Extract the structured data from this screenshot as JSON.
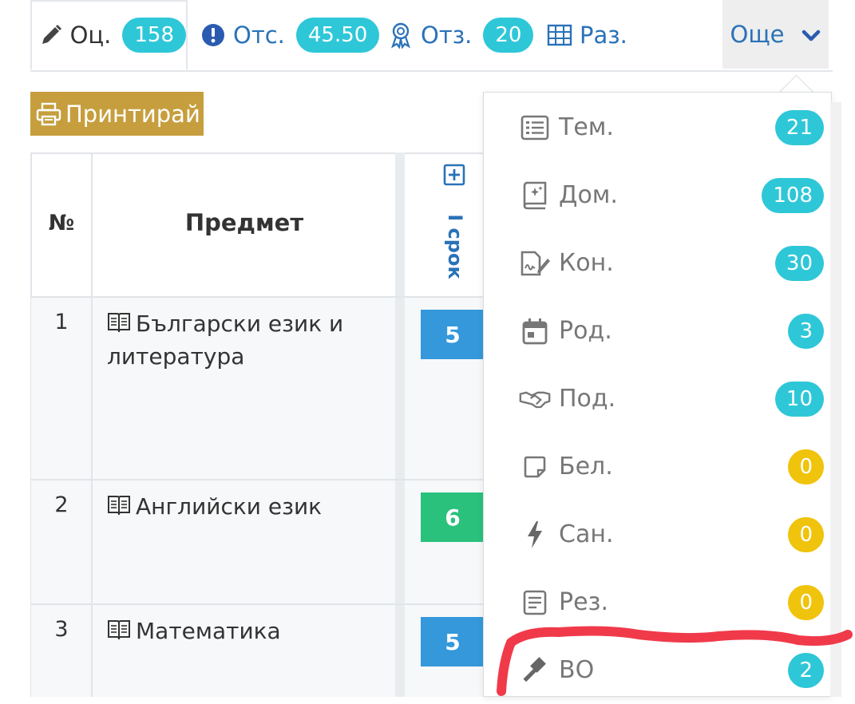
{
  "tabs": [
    {
      "icon": "pencil-icon",
      "label": "Оц.",
      "badge": "158"
    },
    {
      "icon": "exclamation-circle-icon",
      "label": "Отс.",
      "badge": "45.50"
    },
    {
      "icon": "award-icon",
      "label": "Отз.",
      "badge": "20"
    },
    {
      "icon": "table-grid-icon",
      "label": "Раз."
    }
  ],
  "more_tab": {
    "label": "Още",
    "icon": "chevron-down-icon"
  },
  "print_button": {
    "label": "Принтирай",
    "icon": "printer-icon"
  },
  "table": {
    "headers": {
      "num": "№",
      "subject": "Предмет",
      "term": "I срок"
    },
    "rows": [
      {
        "num": "1",
        "subject": "Български език и литература",
        "grade": "5",
        "grade_color": "#3498db"
      },
      {
        "num": "2",
        "subject": "Английски език",
        "grade": "6",
        "grade_color": "#2ac17d"
      },
      {
        "num": "3",
        "subject": "Математика",
        "grade": "5",
        "grade_color": "#3498db"
      }
    ]
  },
  "dropdown": {
    "items": [
      {
        "icon": "list-icon",
        "label": "Тем.",
        "count": "21",
        "status": "info"
      },
      {
        "icon": "homework-book-icon",
        "label": "Дом.",
        "count": "108",
        "status": "info"
      },
      {
        "icon": "test-signature-icon",
        "label": "Кон.",
        "count": "30",
        "status": "info"
      },
      {
        "icon": "calendar-icon",
        "label": "Род.",
        "count": "3",
        "status": "info"
      },
      {
        "icon": "handshake-icon",
        "label": "Под.",
        "count": "10",
        "status": "info"
      },
      {
        "icon": "sticky-note-icon",
        "label": "Бел.",
        "count": "0",
        "status": "warning"
      },
      {
        "icon": "lightning-icon",
        "label": "Сан.",
        "count": "0",
        "status": "warning"
      },
      {
        "icon": "document-icon",
        "label": "Рез.",
        "count": "0",
        "status": "warning"
      },
      {
        "icon": "gavel-icon",
        "label": "ВО",
        "count": "2",
        "status": "info"
      }
    ]
  },
  "colors": {
    "accent": "#2a72b8",
    "badge_info": "#2ec7d8",
    "badge_warning": "#f0c30c",
    "print_button": "#c69e3d",
    "annotation": "#f03a4a"
  }
}
